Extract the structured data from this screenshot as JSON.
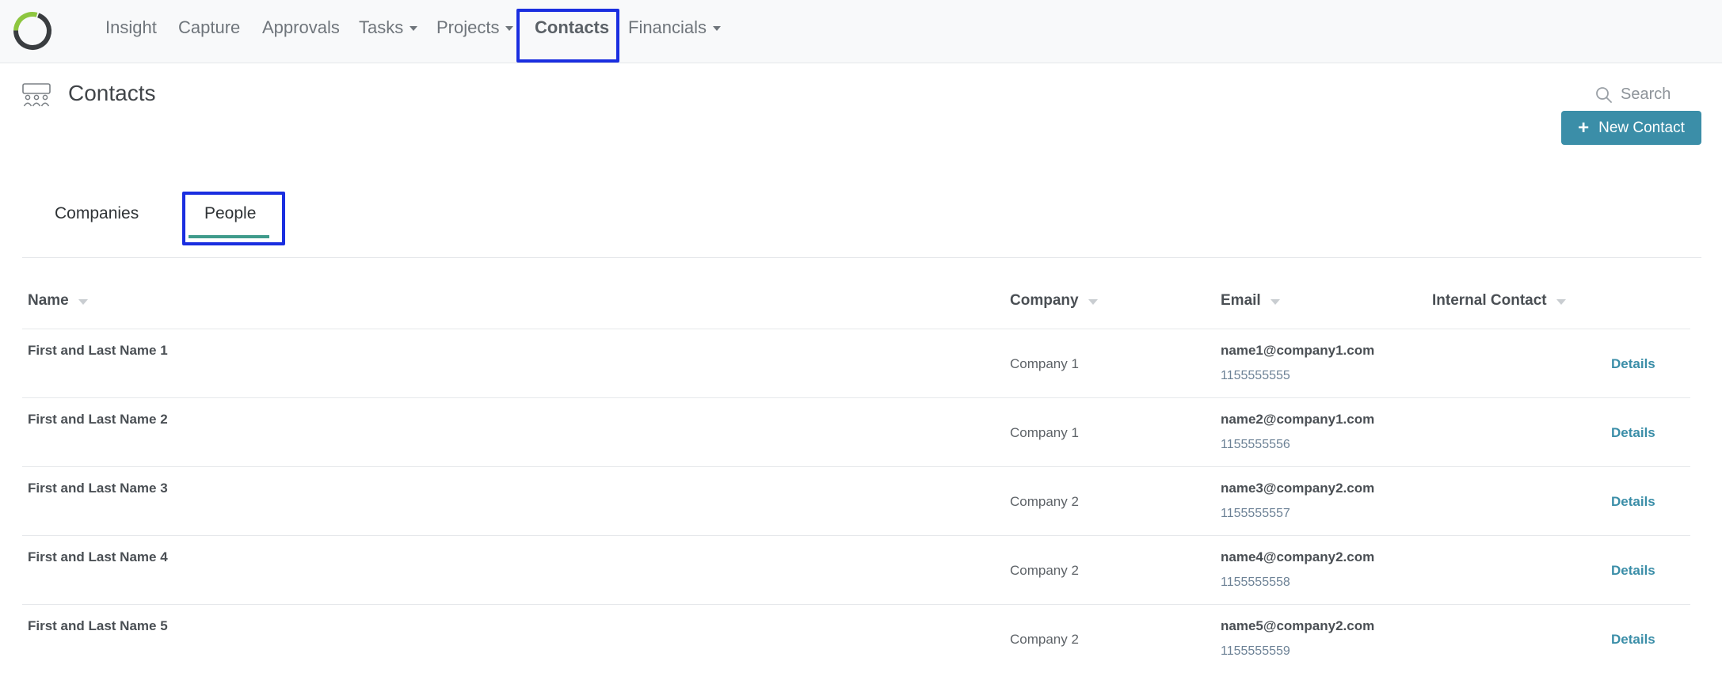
{
  "nav": {
    "items": [
      {
        "label": "Insight",
        "dropdown": false
      },
      {
        "label": "Capture",
        "dropdown": false
      },
      {
        "label": "Approvals",
        "dropdown": false
      },
      {
        "label": "Tasks",
        "dropdown": true
      },
      {
        "label": "Projects",
        "dropdown": true
      },
      {
        "label": "Contacts",
        "dropdown": false,
        "active": true
      },
      {
        "label": "Financials",
        "dropdown": true
      }
    ]
  },
  "page": {
    "title": "Contacts",
    "search_label": "Search",
    "new_button_label": "New Contact"
  },
  "tabs": [
    {
      "label": "Companies",
      "active": false
    },
    {
      "label": "People",
      "active": true
    }
  ],
  "table": {
    "headers": {
      "name": "Name",
      "company": "Company",
      "email": "Email",
      "internal_contact": "Internal Contact"
    },
    "rows": [
      {
        "name": "First and Last Name 1",
        "company": "Company 1",
        "email": "name1@company1.com",
        "phone": "1155555555",
        "action": "Details"
      },
      {
        "name": "First and Last Name 2",
        "company": "Company 1",
        "email": "name2@company1.com",
        "phone": "1155555556",
        "action": "Details"
      },
      {
        "name": "First and Last Name 3",
        "company": "Company 2",
        "email": "name3@company2.com",
        "phone": "1155555557",
        "action": "Details"
      },
      {
        "name": "First and Last Name 4",
        "company": "Company 2",
        "email": "name4@company2.com",
        "phone": "1155555558",
        "action": "Details"
      },
      {
        "name": "First and Last Name 5",
        "company": "Company 2",
        "email": "name5@company2.com",
        "phone": "1155555559",
        "action": "Details"
      }
    ]
  },
  "colors": {
    "accent": "#3b8ea8",
    "tab_underline": "#3f9b8b",
    "highlight_box": "#1a2ee0",
    "logo_dark": "#3a3d40",
    "logo_green": "#8dc63f"
  }
}
